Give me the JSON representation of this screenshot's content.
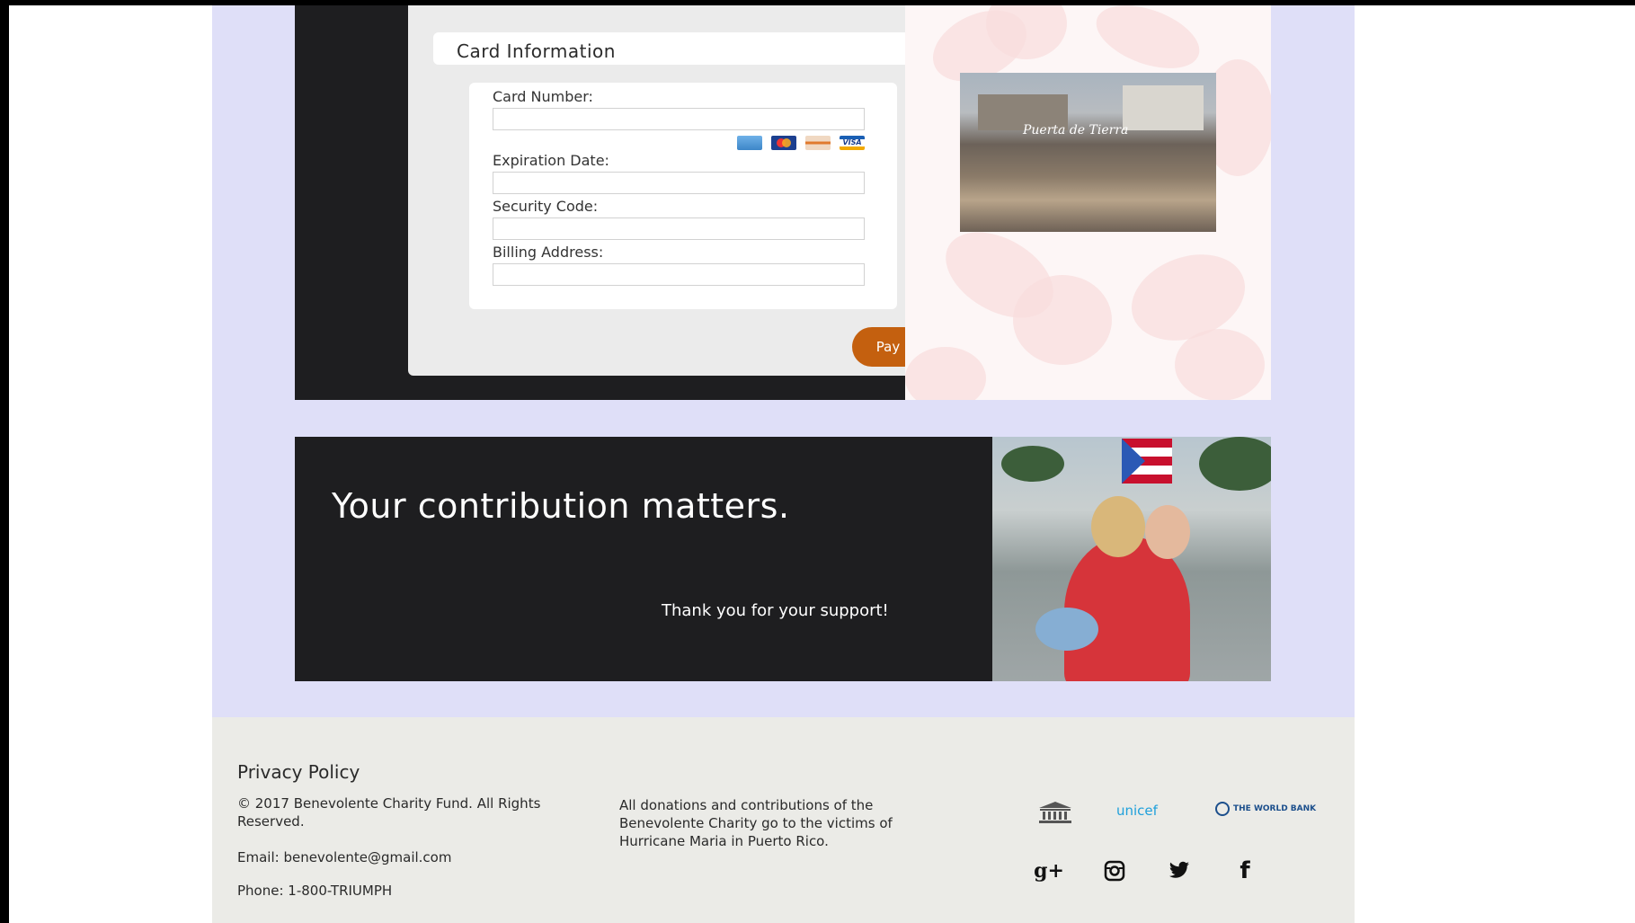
{
  "payment": {
    "section_title": "Card Information",
    "fields": {
      "card_number_label": "Card Number:",
      "expiration_label": "Expiration Date:",
      "security_label": "Security Code:",
      "billing_label": "Billing Address:"
    },
    "card_icons": [
      "amex-card-icon",
      "mastercard-icon",
      "discover-card-icon",
      "visa-card-icon"
    ],
    "card_icon_visa_text": "VISA",
    "pay_label": "Pay",
    "accent_color": "#c4600f"
  },
  "photo_rubble": {
    "sign_text": "Puerta de Tierra"
  },
  "banner": {
    "title": "Your contribution matters.",
    "thanks": "Thank you for your support!"
  },
  "footer": {
    "privacy_title": "Privacy Policy",
    "copyright": "© 2017 Benevolente Charity Fund. All Rights Reserved.",
    "email": "Email: benevolente@gmail.com",
    "phone": "Phone: 1-800-TRIUMPH",
    "donations": "All donations and contributions of the Benevolente Charity go to the victims of Hurricane Maria in Puerto Rico.",
    "partners": {
      "unesco_icon": "unesco-logo-icon",
      "unicef": "unicef",
      "worldbank": "THE WORLD BANK"
    },
    "social": {
      "gplus_glyph": "g+",
      "facebook_glyph": "f",
      "icons": [
        "google-plus-icon",
        "instagram-icon",
        "twitter-icon",
        "facebook-icon"
      ]
    }
  },
  "colors": {
    "page_bg": "#dfdff8",
    "dark_panel": "#1e1e20",
    "footer_bg": "#ebebe7"
  }
}
